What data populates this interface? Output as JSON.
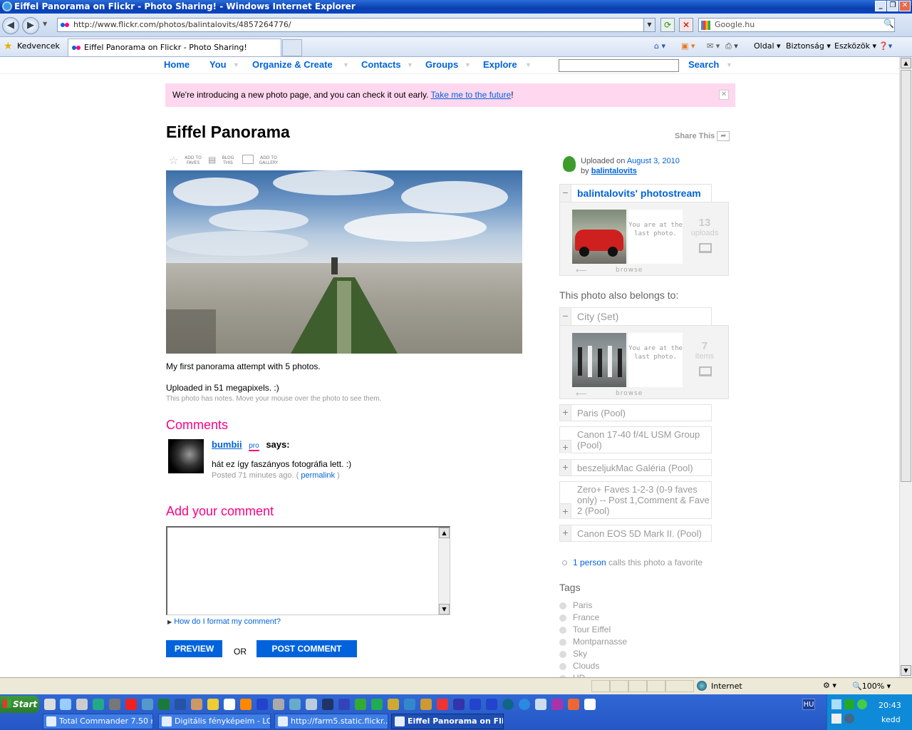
{
  "window": {
    "title": "Eiffel Panorama on Flickr - Photo Sharing! - Windows Internet Explorer"
  },
  "browser": {
    "url": "http://www.flickr.com/photos/balintalovits/4857264776/",
    "search_placeholder": "Google.hu",
    "favorites_label": "Kedvencek",
    "tab_title": "Eiffel Panorama on Flickr - Photo Sharing!",
    "cmd_page": "Oldal",
    "cmd_safety": "Biztonság",
    "cmd_tools": "Eszközök"
  },
  "flickr_nav": {
    "home": "Home",
    "you": "You",
    "organize": "Organize & Create",
    "contacts": "Contacts",
    "groups": "Groups",
    "explore": "Explore",
    "search": "Search"
  },
  "banner": {
    "text": "We're introducing a new photo page, and you can check it out early. ",
    "link": "Take me to the future",
    "tail": "!",
    "close": "✕"
  },
  "photo": {
    "title": "Eiffel Panorama",
    "share": "Share This",
    "actions": {
      "faves": "ADD TO FAVES",
      "blog": "BLOG THIS",
      "gallery": "ADD TO GALLERY"
    },
    "description": "My first panorama attempt with 5 photos.",
    "upload_note": "Uploaded in 51 megapixels. :)",
    "notes_hint": "This photo has notes. Move your mouse over the photo to see them."
  },
  "comments": {
    "heading": "Comments",
    "items": [
      {
        "user": "bumbii",
        "badge": "pro",
        "says": "says:",
        "text": "hát ez így faszányos fotográfia lett. :)",
        "posted": "Posted 71 minutes ago. (",
        "permalink": "permalink",
        "close": ")"
      }
    ],
    "add_heading": "Add your comment",
    "format_help": "How do I format my comment?",
    "preview": "PREVIEW",
    "or": "OR",
    "post": "POST COMMENT"
  },
  "sidebar": {
    "uploaded_on": "Uploaded on ",
    "date": "August 3, 2010",
    "by": "by ",
    "owner": "balintalovits",
    "photostream": {
      "title": "balintalovits' photostream",
      "last": "You are at the last photo.",
      "count": "13",
      "count_label": "uploads",
      "browse": "browse"
    },
    "belongs": "This photo also belongs to:",
    "set": {
      "title": "City (Set)",
      "last": "You are at the last photo.",
      "count": "7",
      "count_label": "items",
      "browse": "browse"
    },
    "pools": [
      "Paris (Pool)",
      "Canon 17-40 f/4L USM Group (Pool)",
      "beszeljukMac Galéria (Pool)",
      "Zero+ Faves 1-2-3 (0-9 faves only) -- Post 1,Comment & Fave 2 (Pool)",
      "Canon EOS 5D Mark II. (Pool)"
    ],
    "fav_count": "1 person",
    "fav_text": " calls this photo a favorite",
    "tags_heading": "Tags",
    "tags": [
      "Paris",
      "France",
      "Tour Eiffel",
      "Montparnasse",
      "Sky",
      "Clouds",
      "HD"
    ]
  },
  "status": {
    "zone": "Internet",
    "zoom": "100%"
  },
  "taskbar": {
    "start": "Start",
    "tasks": [
      "Total Commander 7.50 r...",
      "Digitális fényképeim - LO...",
      "http://farm5.static.flickr....",
      "Eiffel Panorama on Fli..."
    ],
    "lang": "HU",
    "time": "20:43",
    "day": "kedd"
  }
}
